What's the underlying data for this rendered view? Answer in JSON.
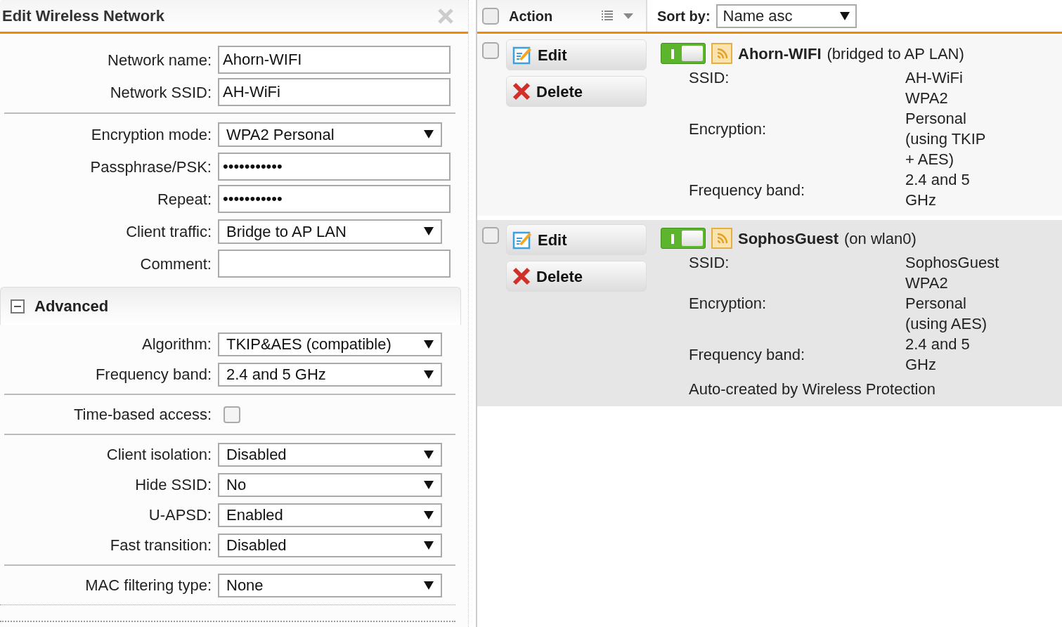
{
  "dialog": {
    "title": "Edit Wireless Network",
    "groups": [
      [
        {
          "kind": "text",
          "label": "Network name:",
          "value": "Ahorn-WIFI"
        },
        {
          "kind": "text",
          "label": "Network SSID:",
          "value": "AH-WiFi"
        }
      ],
      [
        {
          "kind": "select",
          "label": "Encryption mode:",
          "value": "WPA2 Personal"
        },
        {
          "kind": "password",
          "label": "Passphrase/PSK:",
          "masked_text": "•••••••••••"
        },
        {
          "kind": "password",
          "label": "Repeat:",
          "masked_text": "•••••••••••"
        },
        {
          "kind": "select",
          "label": "Client traffic:",
          "value": "Bridge to AP LAN"
        },
        {
          "kind": "text",
          "label": "Comment:"
        }
      ]
    ],
    "advanced": {
      "title": "Advanced",
      "expanded": true,
      "groups": [
        [
          {
            "kind": "select",
            "label": "Algorithm:",
            "value": "TKIP&AES (compatible)"
          },
          {
            "kind": "select",
            "label": "Frequency band:",
            "value": "2.4 and 5 GHz"
          }
        ],
        [
          {
            "kind": "checkbox",
            "label": "Time-based access:",
            "checked": false
          }
        ],
        [
          {
            "kind": "select",
            "label": "Client isolation:",
            "value": "Disabled"
          },
          {
            "kind": "select",
            "label": "Hide SSID:",
            "value": "No"
          },
          {
            "kind": "select",
            "label": "U-APSD:",
            "value": "Enabled"
          },
          {
            "kind": "select",
            "label": "Fast transition:",
            "value": "Disabled"
          }
        ],
        [
          {
            "kind": "select",
            "label": "MAC filtering type:",
            "value": "None"
          }
        ]
      ]
    }
  },
  "list": {
    "select_all": false,
    "action_label": "Action",
    "sort_label": "Sort by:",
    "sort_value": "Name asc",
    "networks": [
      {
        "checked": false,
        "highlighted": false,
        "enabled": true,
        "edit": "Edit",
        "delete": "Delete",
        "name": "Ahorn-WIFI",
        "note": "(bridged to AP LAN)",
        "details": [
          {
            "label": "SSID:",
            "value": "AH-WiFi"
          },
          {
            "label": "Encryption:",
            "value": "WPA2 Personal (using TKIP + AES)"
          },
          {
            "label": "Frequency band:",
            "value": "2.4 and 5 GHz"
          }
        ]
      },
      {
        "checked": false,
        "highlighted": true,
        "enabled": true,
        "edit": "Edit",
        "delete": "Delete",
        "name": "SophosGuest",
        "note": "(on wlan0)",
        "details": [
          {
            "label": "SSID:",
            "value": "SophosGuest"
          },
          {
            "label": "Encryption:",
            "value": "WPA2 Personal (using AES)"
          },
          {
            "label": "Frequency band:",
            "value": "2.4 and 5 GHz"
          }
        ],
        "footnote": "Auto-created by Wireless Protection"
      }
    ]
  }
}
